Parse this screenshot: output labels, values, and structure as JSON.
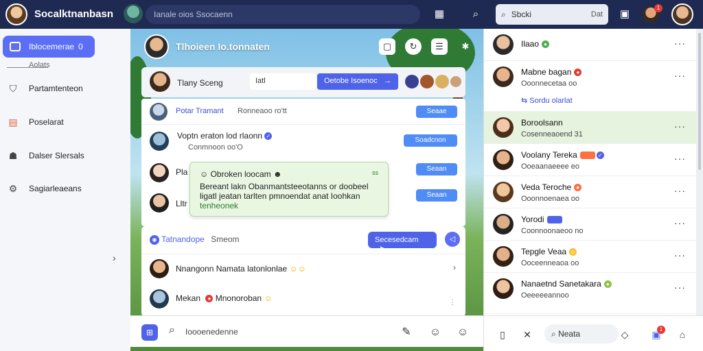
{
  "topbar": {
    "brand": "Socalktnanbasn",
    "search_placeholder": "Ianale oios Ssocaenn",
    "search_box_placeholder": "Sbcki",
    "search_box_tag": "Dat",
    "notification_count": "1"
  },
  "sidebar": {
    "active_item": "Iblocemerae",
    "active_badge": "0",
    "sub_label": "Aolats",
    "items": [
      {
        "label": "Partamtenteon",
        "icon": "shield-icon"
      },
      {
        "label": "Poselarat",
        "icon": "calendar-icon"
      },
      {
        "label": "Dalser Slersals",
        "icon": "group-icon"
      },
      {
        "label": "Sagiarleaeans",
        "icon": "settings-icon"
      }
    ]
  },
  "main": {
    "header_name": "Tlhoieen Io.tonnaten",
    "compose": {
      "name": "Tlany Sceng",
      "input_value": "Iatl",
      "button_label": "Oetobe Isoenoc"
    },
    "feed": [
      {
        "title": "Potar Tramant",
        "meta": "Ronneaoo ro'tt",
        "button": "Seaae"
      },
      {
        "title": "Voptn eraton lod rlaonn",
        "sub": "Conmnoon oo'O",
        "button": "Soadcnon"
      },
      {
        "title": "Pla",
        "button": "Seaan"
      },
      {
        "title": "Lltr",
        "button": "Seaan"
      }
    ],
    "popup": {
      "title": "Obroken loocam",
      "tag": "ss",
      "body": "Bereant lakn Obanmantsteeotanns or doobeel ligatl jeatan tarlten pmnoendat anat Ioohkan",
      "link": "tenheonek"
    },
    "section": {
      "title": "Tatnandope",
      "sub": "Smeom",
      "button": "Secesedcam"
    },
    "comments": [
      {
        "name": "Nnangonn Namata latonlonlae"
      },
      {
        "name": "Mekan",
        "sub": "Mnonoroban"
      }
    ],
    "composer_placeholder": "Ioooenedenne"
  },
  "right": {
    "items": [
      {
        "name": "Ilaao",
        "color": "#2e8b57"
      },
      {
        "name": "Mabne bagan",
        "sub": "Ooonnecetaa oo",
        "color": "#e53935"
      },
      {
        "name": "Boroolsann",
        "sub": "Cosenneaoend 31",
        "color": "#4caf50"
      },
      {
        "name": "Voolany Tereka",
        "sub": "Ooeaanaeeee eo",
        "color": "#ff7043"
      },
      {
        "name": "Veda Teroche",
        "sub": "Ooonnoenaea oo",
        "color": "#ff7043"
      },
      {
        "name": "Yorodi",
        "sub": "Coonnoonaeoo no",
        "color": "#4f63e8"
      },
      {
        "name": "Tepgle Veaa",
        "sub": "Ooceenneaoa oo",
        "color": "#fbc02d"
      },
      {
        "name": "Nanaetnd Sanetakara",
        "sub": "Oeeeeeannoo",
        "color": "#8bc34a"
      }
    ],
    "link": "Sordu olarlat",
    "bottom_search": "Neata",
    "bottom_notif": "1"
  }
}
